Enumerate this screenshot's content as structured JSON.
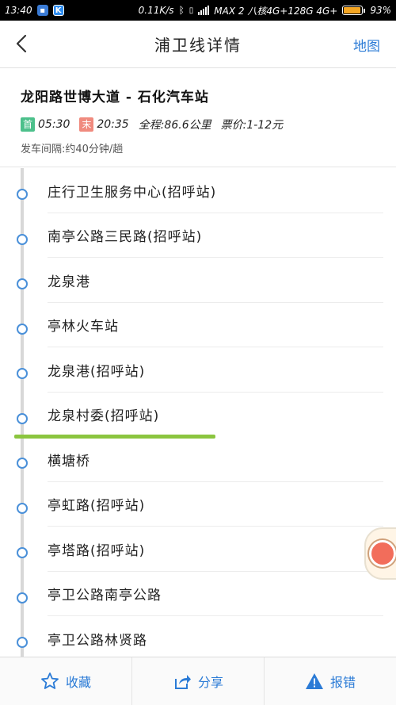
{
  "status_bar": {
    "time": "13:40",
    "app_icon_k": "K",
    "network_speed": "0.11K/s",
    "carrier": "MAX 2 八核4G+128G 4G+",
    "battery_percent": "93%",
    "battery_level": 0.93
  },
  "header": {
    "title": "浦卫线详情",
    "map_link": "地图"
  },
  "route": {
    "name": "龙阳路世博大道 - 石化汽车站",
    "first_tag": "首",
    "first_time": "05:30",
    "last_tag": "末",
    "last_time": "20:35",
    "distance": "全程:86.6公里",
    "fare": "票价:1-12元",
    "interval": "发车间隔:约40分钟/趟"
  },
  "stations": [
    "庄行卫生服务中心(招呼站)",
    "南亭公路三民路(招呼站)",
    "龙泉港",
    "亭林火车站",
    "龙泉港(招呼站)",
    "龙泉村委(招呼站)",
    "横塘桥",
    "亭虹路(招呼站)",
    "亭塔路(招呼站)",
    "亭卫公路南亭公路",
    "亭卫公路林贤路"
  ],
  "bottom_bar": {
    "favorite": "收藏",
    "share": "分享",
    "report": "报错"
  },
  "colors": {
    "accent": "#2b7bd6",
    "highlight": "#8bc53f",
    "first_tag": "#4cc08b",
    "last_tag": "#f08a7e"
  },
  "icons": {
    "back": "chevron-left-icon",
    "favorite": "star-icon",
    "share": "share-icon",
    "report": "warning-icon"
  }
}
